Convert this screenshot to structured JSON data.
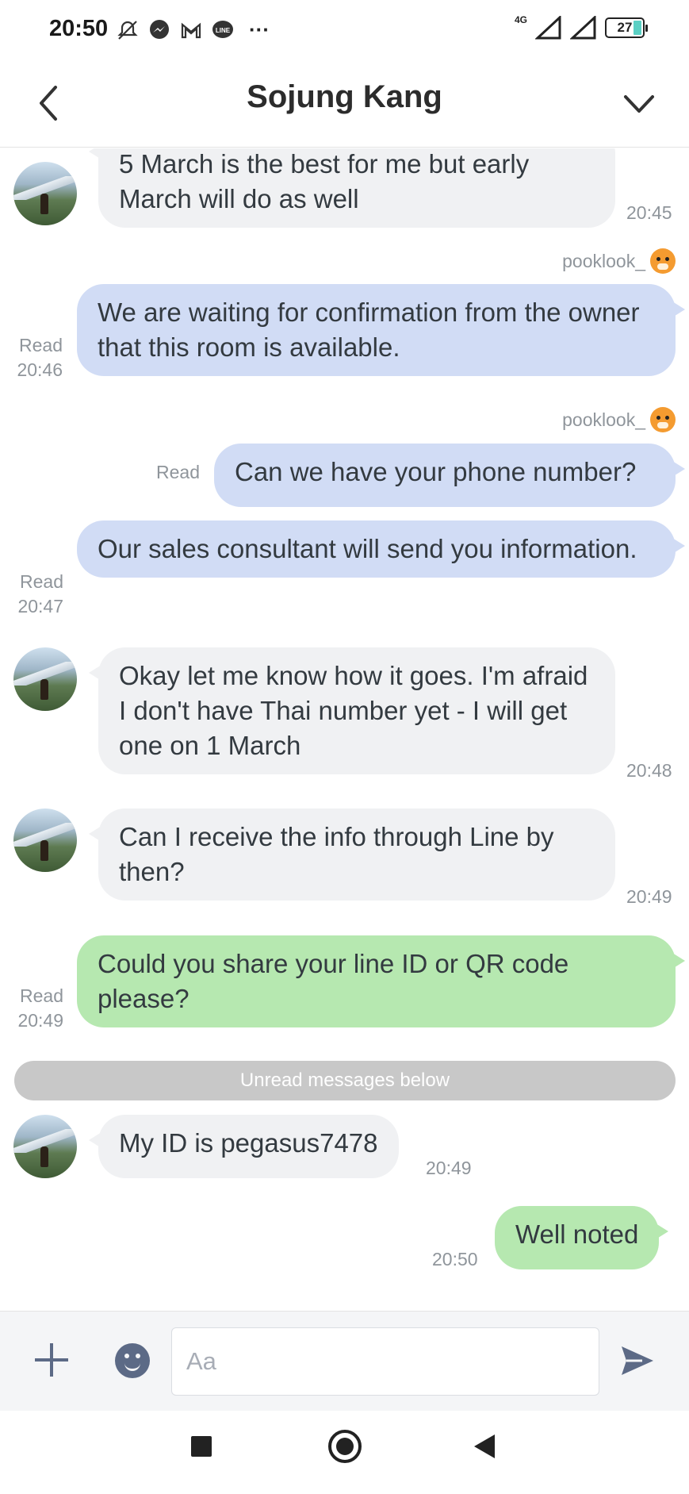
{
  "status_bar": {
    "time": "20:50",
    "network": "4G",
    "battery": "27",
    "notification_icons": [
      "mute-icon",
      "messenger-icon",
      "gmail-icon",
      "line-icon",
      "more-icon"
    ],
    "more": "···"
  },
  "header": {
    "title": "Sojung Kang"
  },
  "messages": [
    {
      "dir": "in",
      "text": "5 March is the best for me but early March will do as well",
      "time": "20:45"
    },
    {
      "dir": "out",
      "sender": "pooklook_",
      "text": "We are waiting for confirmation from the owner that this room is available.",
      "status": "Read",
      "time": "20:46"
    },
    {
      "dir": "out",
      "sender": "pooklook_",
      "text": "Can we have your phone number?",
      "status": "Read"
    },
    {
      "dir": "out",
      "text": "Our sales consultant will send you information.",
      "status": "Read",
      "time": "20:47"
    },
    {
      "dir": "in",
      "text": "Okay let me know how it goes. I'm afraid I don't have Thai number yet - I will get one on 1 March",
      "time": "20:48"
    },
    {
      "dir": "in",
      "text": "Can I receive the info through Line by then?",
      "time": "20:49"
    },
    {
      "dir": "out",
      "text": "Could you share your line ID or QR code please?",
      "status": "Read",
      "time": "20:49"
    },
    {
      "dir": "in",
      "text": "My ID is pegasus7478",
      "time": "20:49"
    },
    {
      "dir": "out",
      "text": "Well noted",
      "time": "20:50"
    }
  ],
  "unread_divider": "Unread messages below",
  "input": {
    "placeholder": "Aa"
  },
  "colors": {
    "incoming_bubble": "#f0f1f3",
    "outgoing_bubble_blue": "#d1dcf5",
    "outgoing_bubble_green": "#b6e8b0",
    "icon_accent": "#5c6a86"
  }
}
